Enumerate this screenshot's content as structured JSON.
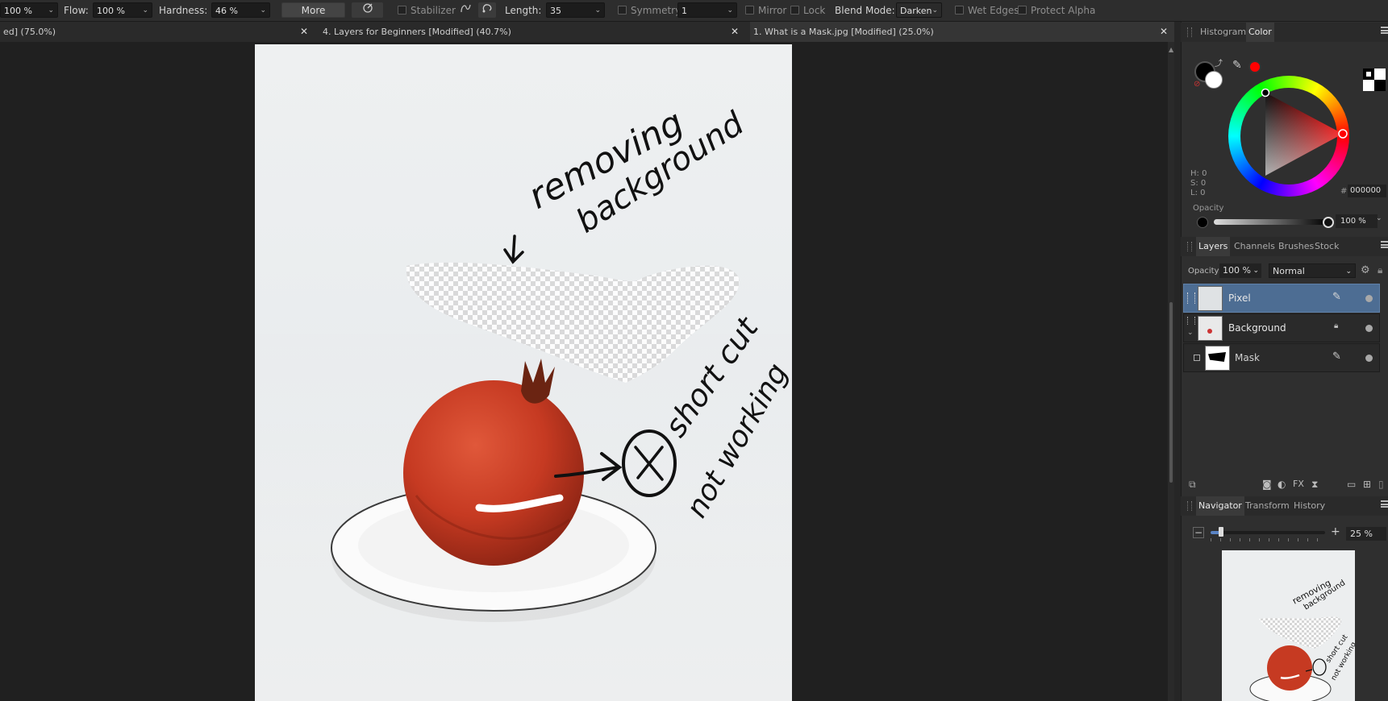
{
  "toolbar": {
    "width_value": "100 %",
    "flow_label": "Flow:",
    "flow_value": "100 %",
    "hardness_label": "Hardness:",
    "hardness_value": "46 %",
    "more_label": "More",
    "stabilizer_label": "Stabilizer",
    "length_label": "Length:",
    "length_value": "35",
    "symmetry_label": "Symmetry",
    "symmetry_value": "1",
    "mirror_label": "Mirror",
    "lock_label": "Lock",
    "blend_mode_label": "Blend Mode:",
    "blend_mode_value": "Darken",
    "wet_edges_label": "Wet Edges",
    "protect_alpha_label": "Protect Alpha"
  },
  "tabs": [
    {
      "label": "ed] (75.0%)"
    },
    {
      "label": "4. Layers for Beginners [Modified] (40.7%)"
    },
    {
      "label": "1. What is a Mask.jpg [Modified] (25.0%)"
    }
  ],
  "annotations": {
    "line1": "removing",
    "line2": "background",
    "line3": "short cut",
    "line4": "not working"
  },
  "color_panel": {
    "tabs": [
      "Histogram",
      "Color"
    ],
    "h": "H: 0",
    "s": "S: 0",
    "l": "L: 0",
    "hex_label": "#:",
    "hex_value": "000000",
    "opacity_label": "Opacity",
    "opacity_value": "100 %"
  },
  "layers_panel": {
    "tabs": [
      "Layers",
      "Channels",
      "Brushes",
      "Stock"
    ],
    "opacity_label": "Opacity:",
    "opacity_value": "100 %",
    "blend_value": "Normal",
    "layers": [
      {
        "name": "Pixel"
      },
      {
        "name": "Background"
      },
      {
        "name": "Mask"
      }
    ]
  },
  "navigator_panel": {
    "tabs": [
      "Navigator",
      "Transform",
      "History"
    ],
    "zoom_value": "25 %",
    "thumb_text1": "removing",
    "thumb_text2": "background",
    "thumb_text3": "short cut",
    "thumb_text4": "not working"
  },
  "colors": {
    "accent": "#4d6d93",
    "primary_color": "#000000",
    "secondary_color": "#ffffff",
    "picker_color": "#ff0000"
  }
}
